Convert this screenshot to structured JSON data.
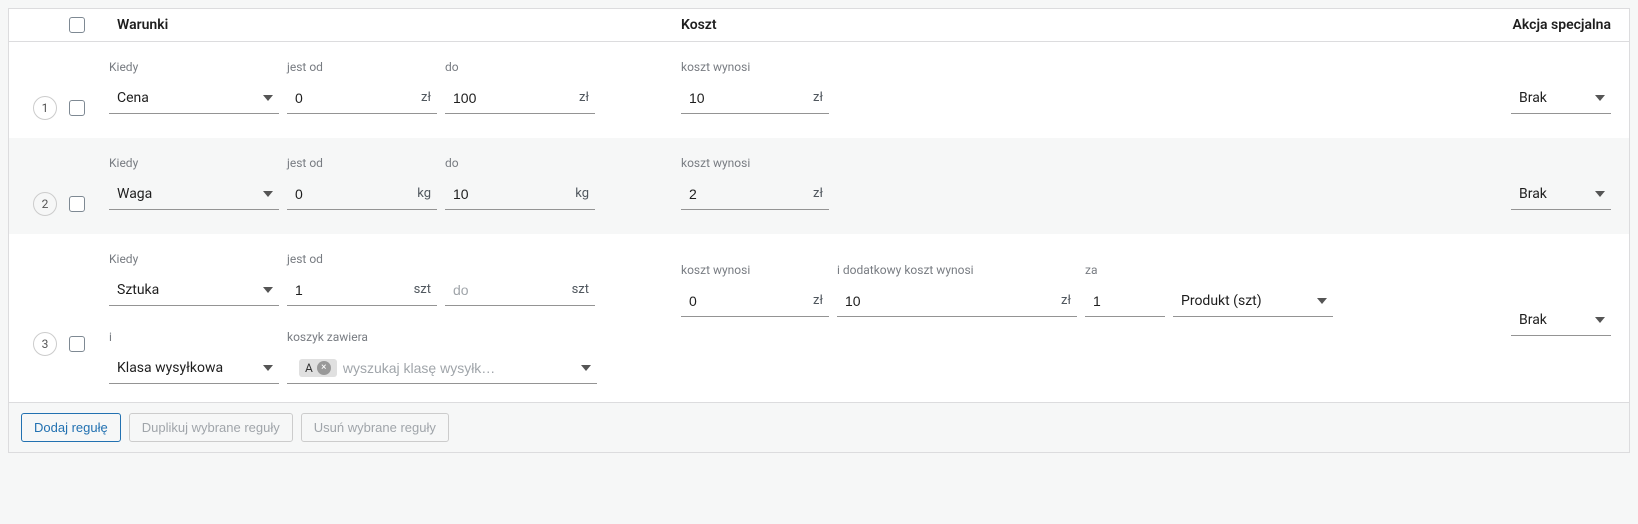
{
  "headers": {
    "conditions": "Warunki",
    "cost": "Koszt",
    "action": "Akcja specjalna"
  },
  "labels": {
    "when": "Kiedy",
    "from": "jest od",
    "to": "do",
    "cost_is": "koszt wynosi",
    "extra_cost_is": "i dodatkowy koszt wynosi",
    "per": "za",
    "and": "i",
    "basket_contains": "koszyk zawiera"
  },
  "units": {
    "currency": "zł",
    "weight": "kg",
    "pieces": "szt"
  },
  "options": {
    "when_price": "Cena",
    "when_weight": "Waga",
    "when_piece": "Sztuka",
    "when_shipping_class": "Klasa wysyłkowa",
    "per_product": "Produkt (szt)",
    "action_none": "Brak"
  },
  "rows": [
    {
      "num": "1",
      "when": "Cena",
      "from": "0",
      "from_unit": "zł",
      "to": "100",
      "to_unit": "zł",
      "cost": "10",
      "action": "Brak"
    },
    {
      "num": "2",
      "when": "Waga",
      "from": "0",
      "from_unit": "kg",
      "to": "10",
      "to_unit": "kg",
      "cost": "2",
      "action": "Brak"
    },
    {
      "num": "3",
      "when": "Sztuka",
      "from": "1",
      "from_unit": "szt",
      "to": "",
      "to_unit": "szt",
      "to_placeholder": "do",
      "cost": "0",
      "extra_cost": "10",
      "per_value": "1",
      "per_unit": "Produkt (szt)",
      "sub_when": "Klasa wysyłkowa",
      "chip": "A",
      "search_placeholder": "wyszukaj klasę wysyłk…",
      "action": "Brak"
    }
  ],
  "footer": {
    "add": "Dodaj regułę",
    "duplicate": "Duplikuj wybrane reguły",
    "delete": "Usuń wybrane reguły"
  }
}
